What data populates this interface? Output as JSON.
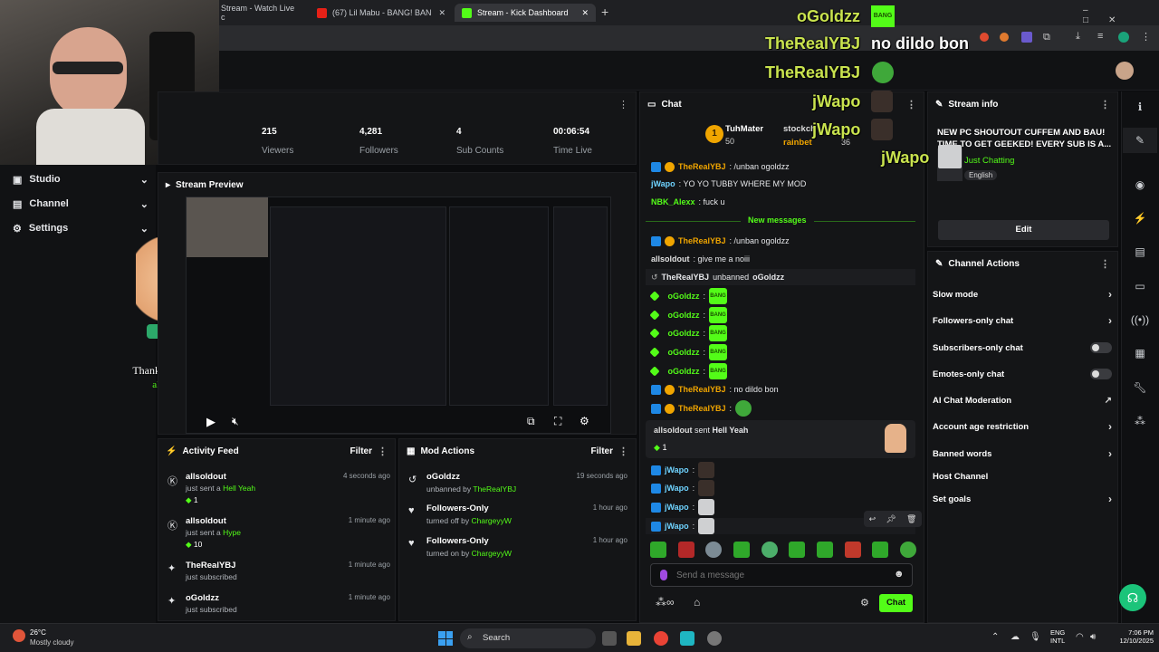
{
  "browser": {
    "tabs": [
      {
        "label": "Stream - Watch Live c"
      },
      {
        "label": "(67) Lil Mabu - BANG! BAN"
      },
      {
        "label": "Stream - Kick Dashboard"
      }
    ],
    "new_tab": "+"
  },
  "stats": [
    {
      "value": "215",
      "label": "Viewers"
    },
    {
      "value": "4,281",
      "label": "Followers"
    },
    {
      "value": "4",
      "label": "Sub Counts"
    },
    {
      "value": "00:06:54",
      "label": "Time Live"
    }
  ],
  "sidebar": {
    "items": [
      {
        "label": "Studio"
      },
      {
        "label": "Channel"
      },
      {
        "label": "Settings"
      }
    ]
  },
  "preview": {
    "title": "Stream Preview",
    "kicks_text": "Thanks for the 1 kicks",
    "kicks_user": "allsoldout"
  },
  "activity": {
    "title": "Activity Feed",
    "filter": "Filter",
    "items": [
      {
        "name": "allsoldout",
        "action": "just sent a",
        "item": "Hell Yeah",
        "amount": "1",
        "time": "4 seconds ago"
      },
      {
        "name": "allsoldout",
        "action": "just sent a",
        "item": "Hype",
        "amount": "10",
        "time": "1 minute ago"
      },
      {
        "name": "TheRealYBJ",
        "action": "just subscribed",
        "time": "1 minute ago"
      },
      {
        "name": "oGoldzz",
        "action": "just subscribed",
        "time": "1 minute ago"
      }
    ]
  },
  "mod_actions": {
    "title": "Mod Actions",
    "filter": "Filter",
    "items": [
      {
        "name": "oGoldzz",
        "action": "unbanned by",
        "by": "TheRealYBJ",
        "time": "19 seconds ago"
      },
      {
        "name": "Followers-Only",
        "action": "turned off by",
        "by": "ChargeyyW",
        "time": "1 hour ago"
      },
      {
        "name": "Followers-Only",
        "action": "turned on by",
        "by": "ChargeyyW",
        "time": "1 hour ago"
      }
    ]
  },
  "chat": {
    "title": "Chat",
    "leaders": [
      {
        "name": "TuhMater",
        "count": "50"
      },
      {
        "name": "stockch",
        "count": ""
      },
      {
        "name": "rainbet",
        "count": "36"
      }
    ],
    "new_messages": "New messages",
    "lines_top": [
      {
        "user": "TheRealYBJ",
        "text": ": /unban ogoldzz"
      },
      {
        "user": "jWapo",
        "text": ": YO YO TUBBY WHERE MY MOD"
      },
      {
        "user": "NBK_Alexx",
        "text": ": fuck u"
      }
    ],
    "lines": [
      {
        "user": "TheRealYBJ",
        "text": ": /unban ogoldzz"
      },
      {
        "user": "allsoldout",
        "text": ": give me a noiii"
      },
      {
        "user": "TheRealYBJ",
        "text": " unbanned ",
        "target": "oGoldzz"
      },
      {
        "user": "oGoldzz",
        "text": ":"
      },
      {
        "user": "oGoldzz",
        "text": ":"
      },
      {
        "user": "oGoldzz",
        "text": ":"
      },
      {
        "user": "oGoldzz",
        "text": ":"
      },
      {
        "user": "oGoldzz",
        "text": ":"
      },
      {
        "user": "TheRealYBJ",
        "text": ": no dildo bon"
      },
      {
        "user": "TheRealYBJ",
        "text": ":"
      }
    ],
    "kick_gift": {
      "user": "allsoldout",
      "text": " sent ",
      "item": "Hell Yeah",
      "amount": "1"
    },
    "lines_bottom": [
      {
        "user": "jWapo",
        "text": ":"
      },
      {
        "user": "jWapo",
        "text": ":"
      },
      {
        "user": "jWapo",
        "text": ":"
      },
      {
        "user": "jWapo",
        "text": ":"
      }
    ],
    "emote_word": "BANG",
    "input_placeholder": "Send a message",
    "send_label": "Chat"
  },
  "stream_info": {
    "title": "Stream info",
    "stream_title": "NEW PC SHOUTOUT CUFFEM AND BAU! TIME TO GET GEEKED! EVERY SUB IS A...",
    "category": "Just Chatting",
    "language": "English",
    "edit": "Edit"
  },
  "channel_actions": {
    "title": "Channel Actions",
    "items": [
      {
        "label": "Slow mode",
        "control": "chevron"
      },
      {
        "label": "Followers-only chat",
        "control": "chevron"
      },
      {
        "label": "Subscribers-only chat",
        "control": "toggle"
      },
      {
        "label": "Emotes-only chat",
        "control": "toggle"
      },
      {
        "label": "AI Chat Moderation",
        "control": "external"
      },
      {
        "label": "Account age restriction",
        "control": "chevron"
      },
      {
        "label": "Banned words",
        "control": "chevron"
      },
      {
        "label": "Host Channel",
        "control": "none"
      },
      {
        "label": "Set goals",
        "control": "chevron"
      }
    ]
  },
  "overlay": {
    "lines": [
      {
        "user": "oGoldzz",
        "text": "BANG"
      },
      {
        "user": "TheRealYBJ",
        "text": "no dildo bon"
      },
      {
        "user": "TheRealYBJ",
        "text": ""
      },
      {
        "user": "jWapo",
        "text": ""
      },
      {
        "user": "jWapo",
        "text": ""
      },
      {
        "user": "jWapo",
        "text": ""
      }
    ]
  },
  "taskbar": {
    "weather_temp": "26°C",
    "weather_desc": "Mostly cloudy",
    "search": "Search",
    "lang": "ENG",
    "lang2": "INTL",
    "time": "7:06 PM",
    "date": "12/10/2025"
  },
  "colors": {
    "accent": "#53fc18",
    "bg": "#0b0c0e",
    "panel": "#141517"
  }
}
